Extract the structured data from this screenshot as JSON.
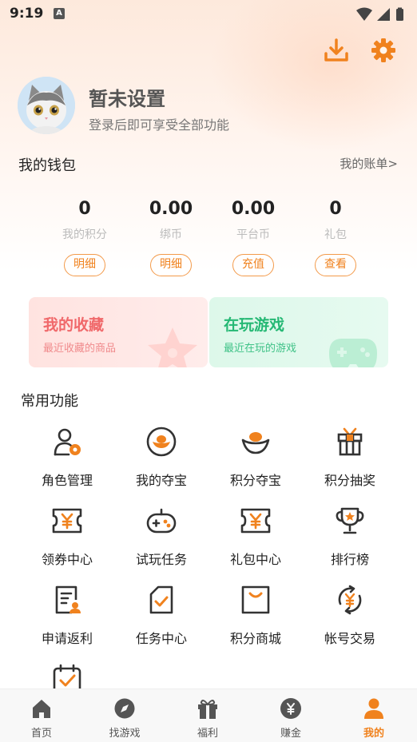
{
  "status_bar": {
    "time": "9:19",
    "keyboard_badge": "A",
    "icons": [
      "wifi-icon",
      "signal-icon",
      "battery-icon"
    ]
  },
  "top_actions": {
    "download_icon": "download-icon",
    "settings_icon": "gear-icon"
  },
  "profile": {
    "avatar_icon": "cat-avatar-icon",
    "name": "暂未设置",
    "subtitle": "登录后即可享受全部功能"
  },
  "wallet": {
    "title": "我的钱包",
    "bills_link": "我的账单>",
    "items": [
      {
        "value": "0",
        "label": "我的积分",
        "button": "明细"
      },
      {
        "value": "0.00",
        "label": "绑币",
        "button": "明细"
      },
      {
        "value": "0.00",
        "label": "平台币",
        "button": "充值"
      },
      {
        "value": "0",
        "label": "礼包",
        "button": "查看"
      }
    ]
  },
  "cards": {
    "favorites": {
      "title": "我的收藏",
      "subtitle": "最近收藏的商品",
      "color": "#f0686a"
    },
    "playing": {
      "title": "在玩游戏",
      "subtitle": "最近在玩的游戏",
      "color": "#25b874"
    }
  },
  "common": {
    "title": "常用功能",
    "items": [
      {
        "label": "角色管理",
        "icon": "role-manage-icon"
      },
      {
        "label": "我的夺宝",
        "icon": "gold-ingot-circle-icon"
      },
      {
        "label": "积分夺宝",
        "icon": "gold-ingot-icon"
      },
      {
        "label": "积分抽奖",
        "icon": "gift-box-icon"
      },
      {
        "label": "领券中心",
        "icon": "coupon-icon"
      },
      {
        "label": "试玩任务",
        "icon": "gamepad-icon"
      },
      {
        "label": "礼包中心",
        "icon": "gift-coupon-icon"
      },
      {
        "label": "排行榜",
        "icon": "trophy-icon"
      },
      {
        "label": "申请返利",
        "icon": "rebate-document-icon"
      },
      {
        "label": "任务中心",
        "icon": "task-check-icon"
      },
      {
        "label": "积分商城",
        "icon": "shopping-bag-icon"
      },
      {
        "label": "帐号交易",
        "icon": "exchange-icon"
      },
      {
        "label": "",
        "icon": "calendar-check-icon"
      }
    ]
  },
  "bottom_nav": {
    "items": [
      {
        "label": "首页",
        "icon": "home-icon",
        "active": false
      },
      {
        "label": "找游戏",
        "icon": "compass-icon",
        "active": false
      },
      {
        "label": "福利",
        "icon": "gift-icon",
        "active": false
      },
      {
        "label": "赚金",
        "icon": "money-bag-icon",
        "active": false
      },
      {
        "label": "我的",
        "icon": "person-icon",
        "active": true
      }
    ]
  },
  "colors": {
    "accent": "#f0821e",
    "icon_dark": "#333333",
    "nav_inactive": "#555555"
  }
}
